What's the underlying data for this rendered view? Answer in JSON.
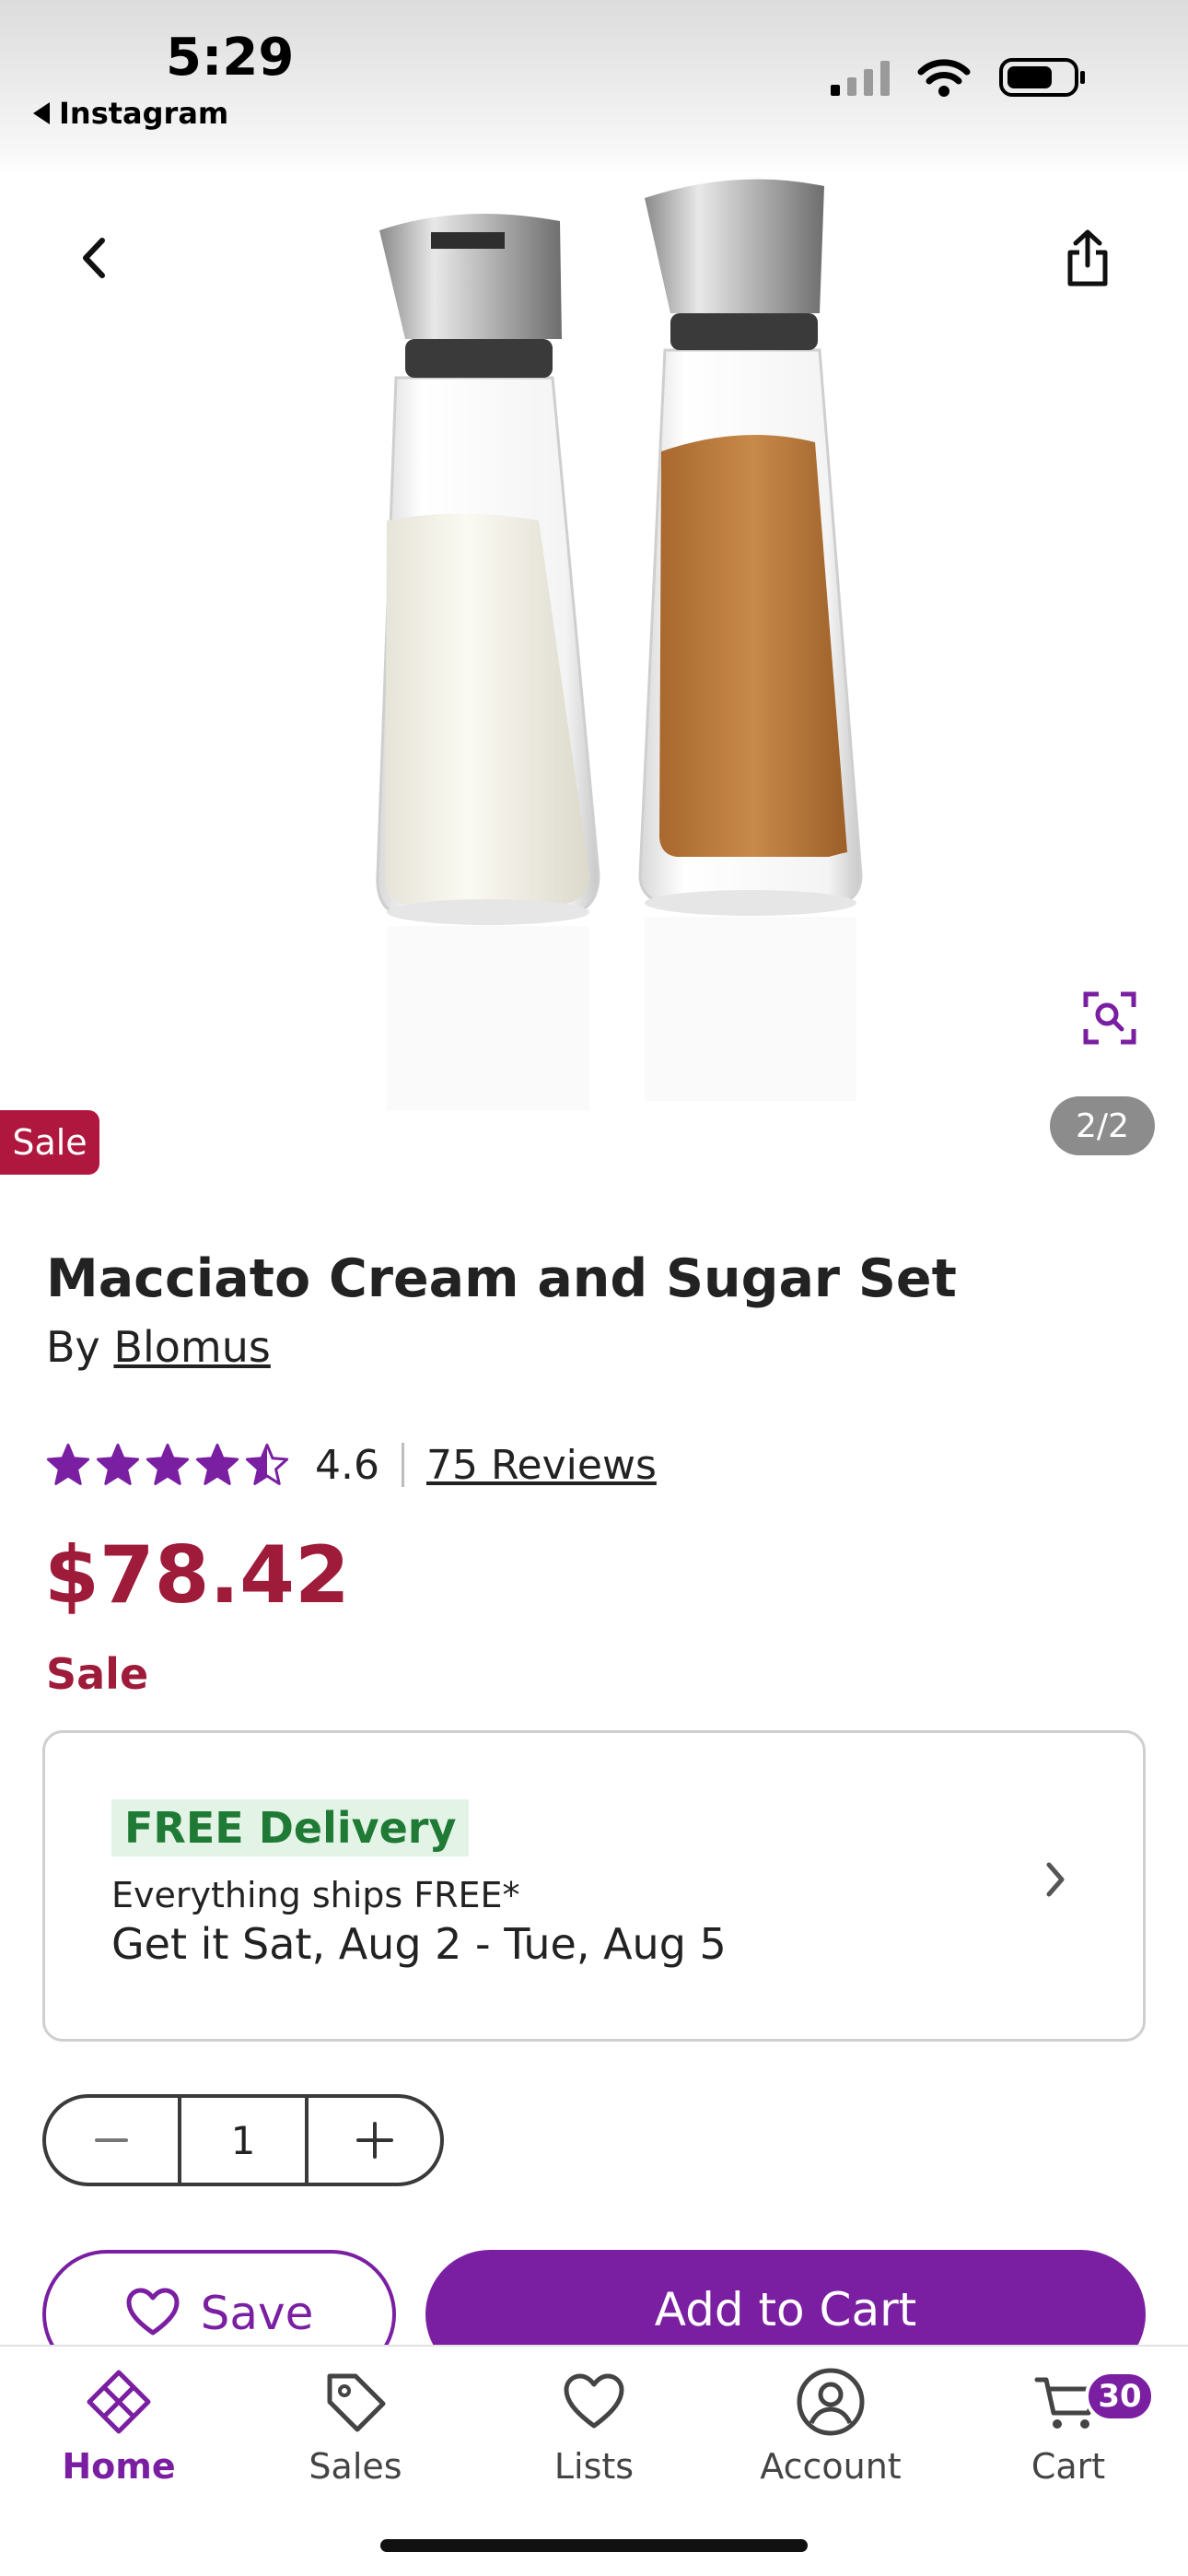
{
  "status_bar": {
    "time": "5:29",
    "back_app": "Instagram"
  },
  "hero": {
    "image_counter": "2/2",
    "sale_tag": "Sale"
  },
  "product": {
    "title": "Macciato Cream and Sugar Set",
    "by_prefix": "By",
    "brand": "Blomus",
    "rating": "4.6",
    "rating_value": 4.6,
    "reviews": "75 Reviews",
    "price": "$78.42",
    "sale_label": "Sale"
  },
  "delivery": {
    "badge": "FREE Delivery",
    "ships": "Everything ships FREE*",
    "eta": "Get it Sat, Aug 2 - Tue, Aug 5"
  },
  "quantity": {
    "value": "1"
  },
  "actions": {
    "save": "Save",
    "add_to_cart": "Add to Cart"
  },
  "tabs": [
    {
      "label": "Home",
      "icon": "home-icon",
      "active": true
    },
    {
      "label": "Sales",
      "icon": "tag-icon"
    },
    {
      "label": "Lists",
      "icon": "heart-icon"
    },
    {
      "label": "Account",
      "icon": "account-icon"
    },
    {
      "label": "Cart",
      "icon": "cart-icon",
      "badge": "30"
    }
  ],
  "colors": {
    "brand_purple": "#7a1fa2",
    "sale_red": "#9e1b3a",
    "free_green": "#1e7a34"
  }
}
